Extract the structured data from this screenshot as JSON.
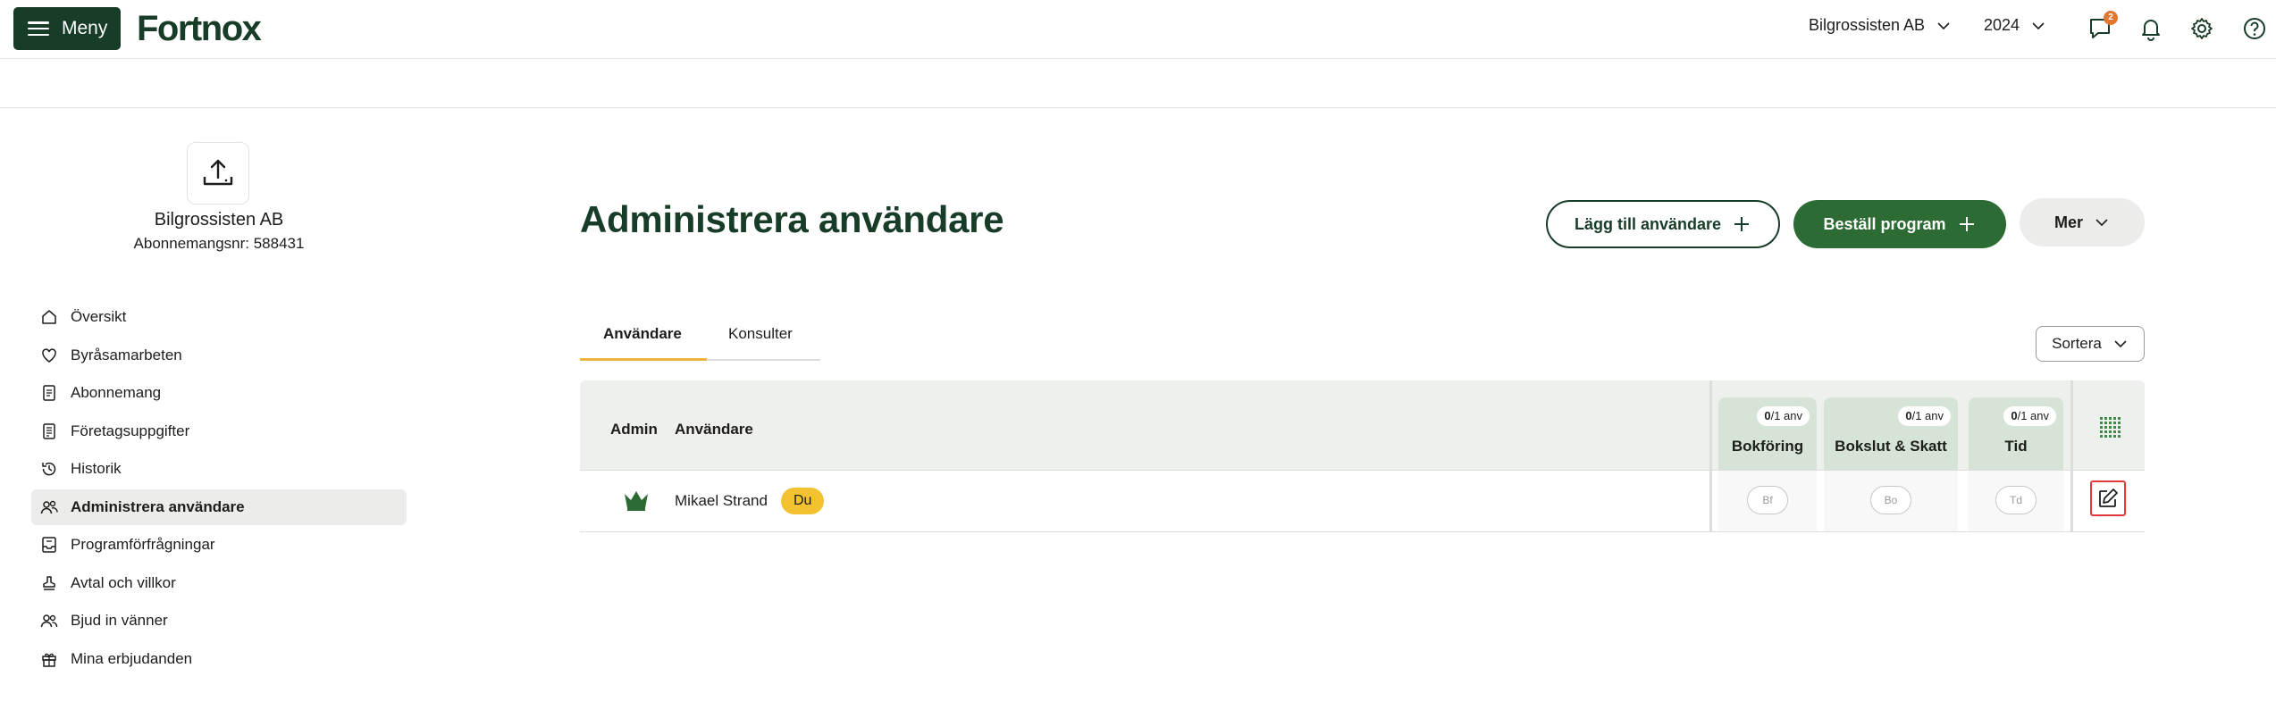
{
  "header": {
    "menu_label": "Meny",
    "logo_text": "Fortnox",
    "company": "Bilgrossisten AB",
    "year": "2024",
    "messages_badge": "2"
  },
  "sidebar": {
    "company_name": "Bilgrossisten AB",
    "subscription": "Abonnemangsnr: 588431",
    "items": [
      {
        "label": "Översikt",
        "icon": "home-icon",
        "active": false
      },
      {
        "label": "Byråsamarbeten",
        "icon": "heart-icon",
        "active": false
      },
      {
        "label": "Abonnemang",
        "icon": "document-icon",
        "active": false
      },
      {
        "label": "Företagsuppgifter",
        "icon": "document-list-icon",
        "active": false
      },
      {
        "label": "Historik",
        "icon": "history-icon",
        "active": false
      },
      {
        "label": "Administrera användare",
        "icon": "users-icon",
        "active": true
      },
      {
        "label": "Programförfrågningar",
        "icon": "inbox-icon",
        "active": false
      },
      {
        "label": "Avtal och villkor",
        "icon": "stamp-icon",
        "active": false
      },
      {
        "label": "Bjud in vänner",
        "icon": "invite-users-icon",
        "active": false
      },
      {
        "label": "Mina erbjudanden",
        "icon": "gift-icon",
        "active": false
      }
    ]
  },
  "main": {
    "title": "Administrera användare",
    "add_user_label": "Lägg till användare",
    "order_program_label": "Beställ program",
    "more_label": "Mer",
    "tabs": [
      {
        "label": "Användare",
        "active": true
      },
      {
        "label": "Konsulter",
        "active": false
      }
    ],
    "sort_label": "Sortera"
  },
  "table": {
    "col_admin": "Admin",
    "col_user": "Användare",
    "programs": [
      {
        "name": "Bokföring",
        "used": "0",
        "quota": "/1 anv",
        "chip": "Bf"
      },
      {
        "name": "Bokslut & Skatt",
        "used": "0",
        "quota": "/1 anv",
        "chip": "Bo"
      },
      {
        "name": "Tid",
        "used": "0",
        "quota": "/1 anv",
        "chip": "Td"
      }
    ],
    "rows": [
      {
        "name": "Mikael Strand",
        "badge": "Du",
        "admin": true
      }
    ]
  },
  "colors": {
    "brand_dark": "#173c27",
    "brand_green": "#2d6b34",
    "accent_yellow": "#f2c230",
    "program_header": "#d5e4d6"
  }
}
